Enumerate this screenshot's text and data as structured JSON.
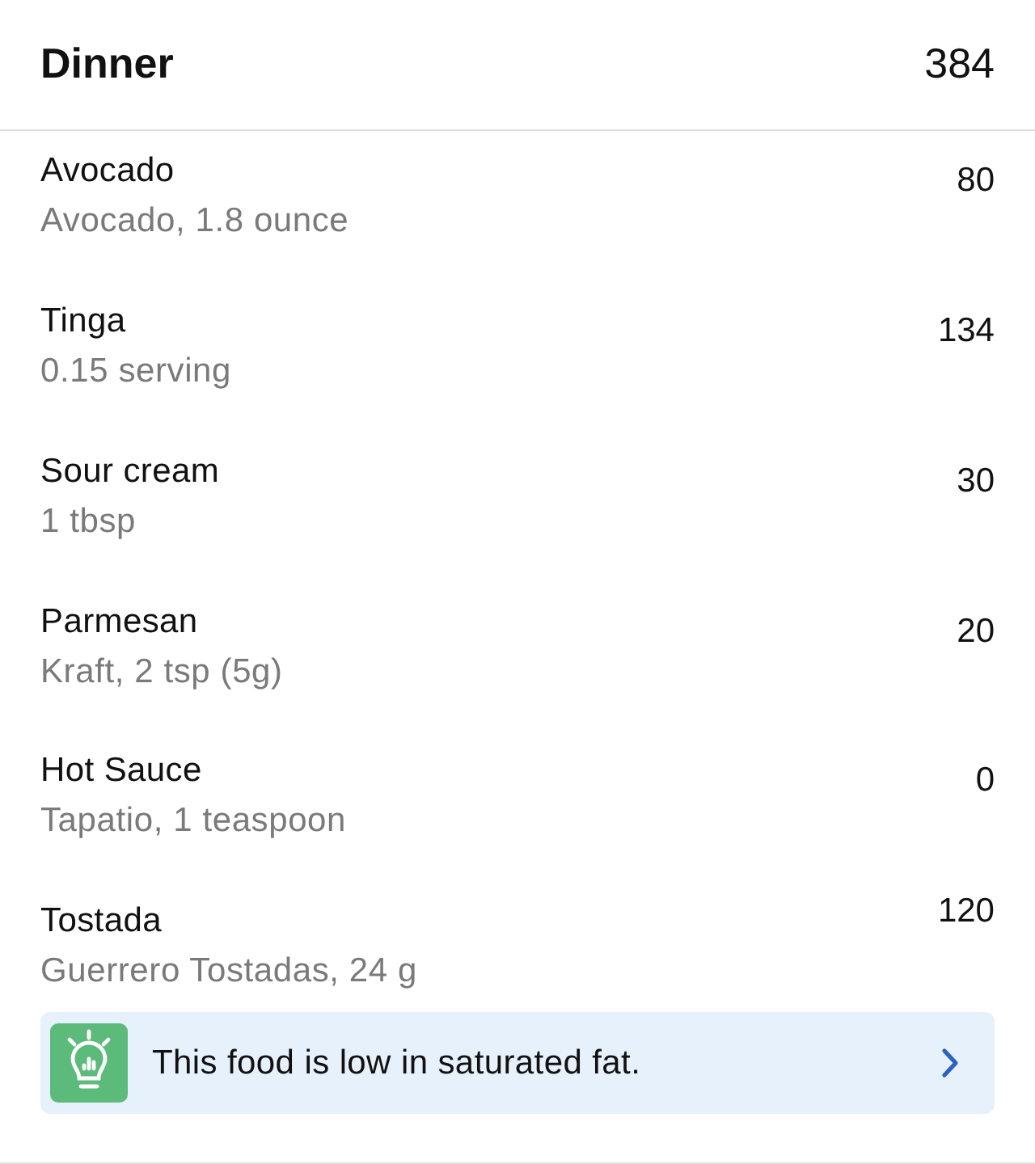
{
  "meal": {
    "title": "Dinner",
    "calories": "384"
  },
  "foods": [
    {
      "name": "Avocado",
      "detail": "Avocado, 1.8 ounce",
      "calories": "80"
    },
    {
      "name": "Tinga",
      "detail": "0.15 serving",
      "calories": "134"
    },
    {
      "name": "Sour cream",
      "detail": "1 tbsp",
      "calories": "30"
    },
    {
      "name": "Parmesan",
      "detail": "Kraft, 2 tsp (5g)",
      "calories": "20"
    },
    {
      "name": "Hot Sauce",
      "detail": "Tapatio, 1 teaspoon",
      "calories": "0"
    },
    {
      "name": "Tostada",
      "detail": "Guerrero Tostadas, 24 g",
      "calories": "120"
    }
  ],
  "tip": {
    "text": "This food is low in saturated fat."
  }
}
